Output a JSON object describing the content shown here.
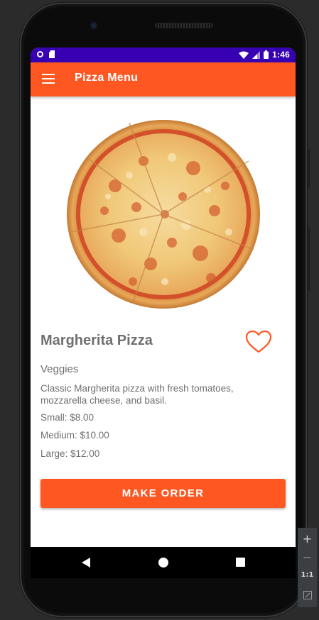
{
  "status_bar": {
    "time": "1:46",
    "left_icons": [
      "circle-notification-icon",
      "sd-card-icon"
    ],
    "right_icons": [
      "wifi-icon",
      "signal-icon",
      "battery-icon"
    ]
  },
  "app_bar": {
    "title": "Pizza Menu",
    "menu_icon": "hamburger-menu-icon",
    "color": "#ff5722"
  },
  "product": {
    "name": "Margherita Pizza",
    "category": "Veggies",
    "description": "Classic Margherita pizza with fresh tomatoes, mozzarella cheese, and basil.",
    "prices": [
      {
        "label": "Small: $8.00"
      },
      {
        "label": "Medium: $10.00"
      },
      {
        "label": "Large: $12.00"
      }
    ],
    "favorite_icon": "heart-outline-icon",
    "order_button": "MAKE ORDER"
  },
  "nav_bar": {
    "icons": [
      "back-icon",
      "home-icon",
      "recents-icon"
    ]
  },
  "emulator_toolbar": {
    "zoom_in": "+",
    "zoom_out": "−",
    "actual_size": "1:1"
  },
  "colors": {
    "accent": "#ff5722",
    "status_bar": "#3700b3",
    "text": "#6f6f6f"
  }
}
